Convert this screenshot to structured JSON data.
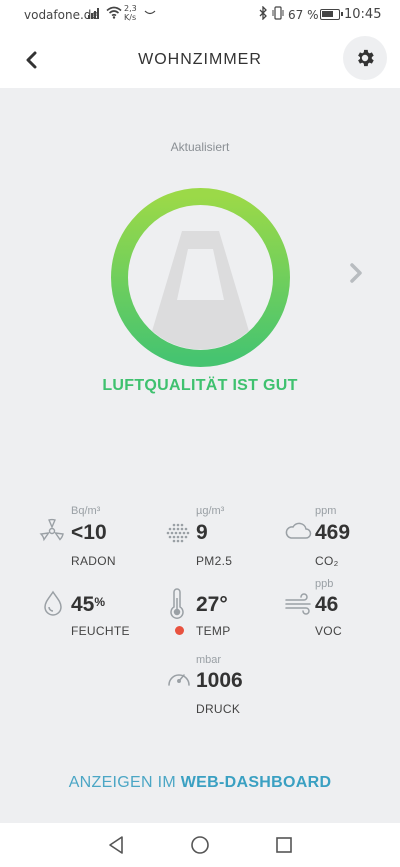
{
  "status_bar": {
    "carrier": "vodafone.de",
    "net_speed_value": "2,3",
    "net_speed_unit": "K/s",
    "battery_percent": "67 %",
    "time": "10:45"
  },
  "header": {
    "title": "WOHNZIMMER"
  },
  "room_status": {
    "updated_label": "Aktualisiert",
    "quality_text": "LUFTQUALITÄT IST GUT"
  },
  "sensors": {
    "radon": {
      "unit": "Bq/m³",
      "value": "<10",
      "label": "RADON",
      "icon": "radiation-icon"
    },
    "pm25": {
      "unit": "µg/m³",
      "value": "9",
      "label": "PM2.5",
      "icon": "particles-icon"
    },
    "co2": {
      "unit": "ppm",
      "value": "469",
      "label": "CO₂",
      "icon": "cloud-icon"
    },
    "humidity": {
      "value": "45",
      "suffix": "%",
      "label": "FEUCHTE",
      "icon": "droplet-icon"
    },
    "temp": {
      "value": "27°",
      "label": "TEMP",
      "icon": "thermometer-icon",
      "status_color": "#e8523f"
    },
    "voc": {
      "unit": "ppb",
      "value": "46",
      "label": "VOC",
      "icon": "wind-icon"
    },
    "pressure": {
      "unit": "mbar",
      "value": "1006",
      "label": "DRUCK",
      "icon": "gauge-icon"
    }
  },
  "dashboard_link": {
    "prefix": "ANZEIGEN IM",
    "target": "WEB-DASHBOARD"
  },
  "colors": {
    "good": "#3fc16f",
    "link": "#3aa0c2",
    "warning": "#e8523f"
  }
}
